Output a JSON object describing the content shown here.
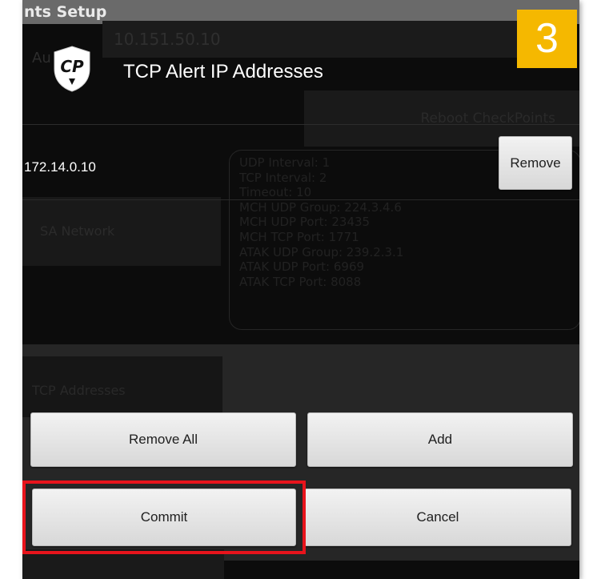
{
  "background": {
    "title": "nts Setup",
    "ip_value": "10.151.50.10",
    "au_label": "Au",
    "reboot_label": "Reboot CheckPoints",
    "stats": [
      "UDP Interval: 1",
      "TCP Interval: 2",
      "Timeout: 10",
      "MCH UDP Group: 224.3.4.6",
      "MCH UDP Port: 23435",
      "MCH TCP Port: 1771",
      "ATAK UDP Group: 239.2.3.1",
      "ATAK UDP Port: 6969",
      "ATAK TCP Port: 8088"
    ],
    "sa_network_label": "SA Network",
    "tcp_addresses_label": "TCP Addresses"
  },
  "dialog": {
    "title": "TCP Alert IP Addresses",
    "logo_text": "CP",
    "ip_address": "172.14.0.10",
    "remove_label": "Remove",
    "remove_all_label": "Remove All",
    "add_label": "Add",
    "commit_label": "Commit",
    "cancel_label": "Cancel"
  },
  "annotation": {
    "step_number": "3",
    "badge_color": "#f5b800",
    "highlight_color": "#e8141c"
  }
}
